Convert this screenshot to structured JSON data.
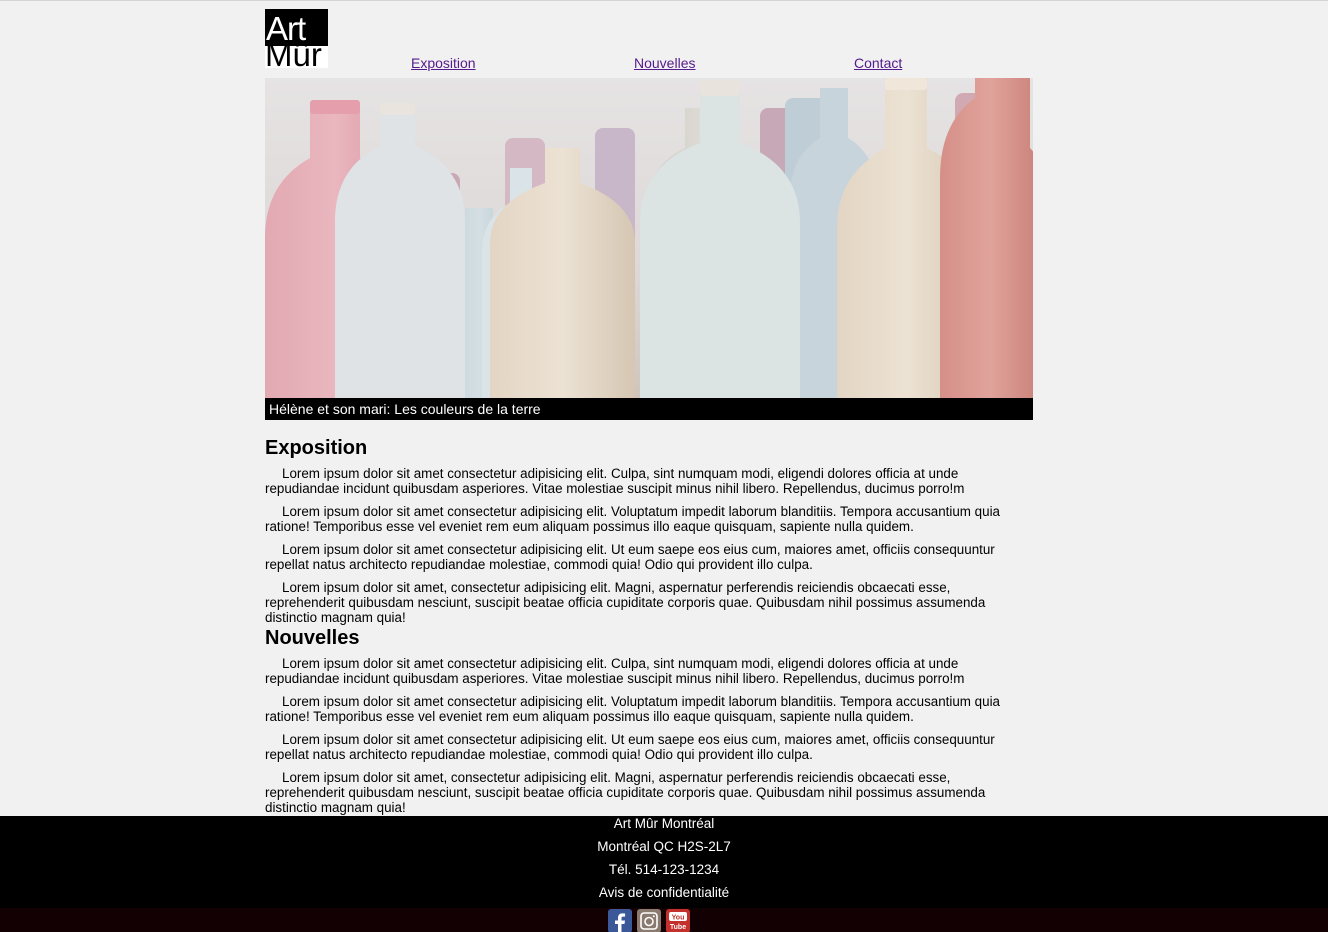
{
  "header": {
    "logo_line1": "Art",
    "logo_line2": "Mûr",
    "nav": [
      {
        "label": "Exposition"
      },
      {
        "label": "Nouvelles"
      },
      {
        "label": "Contact"
      }
    ]
  },
  "hero": {
    "caption": "Hélène et son mari: Les couleurs de la terre"
  },
  "sections": [
    {
      "title": "Exposition",
      "paragraphs": [
        "Lorem ipsum dolor sit amet consectetur adipisicing elit. Culpa, sint numquam modi, eligendi dolores officia at unde repudiandae incidunt quibusdam asperiores. Vitae molestiae suscipit minus nihil libero. Repellendus, ducimus porro!m",
        "Lorem ipsum dolor sit amet consectetur adipisicing elit. Voluptatum impedit laborum blanditiis. Tempora accusantium quia ratione! Temporibus esse vel eveniet rem eum aliquam possimus illo eaque quisquam, sapiente nulla quidem.",
        "Lorem ipsum dolor sit amet consectetur adipisicing elit. Ut eum saepe eos eius cum, maiores amet, officiis consequuntur repellat natus architecto repudiandae molestiae, commodi quia! Odio qui provident illo culpa.",
        "Lorem ipsum dolor sit amet, consectetur adipisicing elit. Magni, aspernatur perferendis reiciendis obcaecati esse, reprehenderit quibusdam nesciunt, suscipit beatae officia cupiditate corporis quae. Quibusdam nihil possimus assumenda distinctio magnam quia!"
      ]
    },
    {
      "title": "Nouvelles",
      "paragraphs": [
        "Lorem ipsum dolor sit amet consectetur adipisicing elit. Culpa, sint numquam modi, eligendi dolores officia at unde repudiandae incidunt quibusdam asperiores. Vitae molestiae suscipit minus nihil libero. Repellendus, ducimus porro!m",
        "Lorem ipsum dolor sit amet consectetur adipisicing elit. Voluptatum impedit laborum blanditiis. Tempora accusantium quia ratione! Temporibus esse vel eveniet rem eum aliquam possimus illo eaque quisquam, sapiente nulla quidem.",
        "Lorem ipsum dolor sit amet consectetur adipisicing elit. Ut eum saepe eos eius cum, maiores amet, officiis consequuntur repellat natus architecto repudiandae molestiae, commodi quia! Odio qui provident illo culpa.",
        "Lorem ipsum dolor sit amet, consectetur adipisicing elit. Magni, aspernatur perferendis reiciendis obcaecati esse, reprehenderit quibusdam nesciunt, suscipit beatae officia cupiditate corporis quae. Quibusdam nihil possimus assumenda distinctio magnam quia!"
      ]
    }
  ],
  "footer": {
    "name": "Art Mûr Montréal",
    "address": "Montréal QC H2S-2L7",
    "phone": "Tél. 514-123-1234",
    "privacy": "Avis de confidentialité",
    "social": [
      {
        "icon": "facebook-icon",
        "color": "#3b5998"
      },
      {
        "icon": "instagram-icon",
        "color": "#8a7a70"
      },
      {
        "icon": "youtube-icon",
        "color": "#c4302b"
      }
    ]
  },
  "colors": {
    "background": "#f1f1f1",
    "link": "#551a8b",
    "footer": "#000000"
  }
}
